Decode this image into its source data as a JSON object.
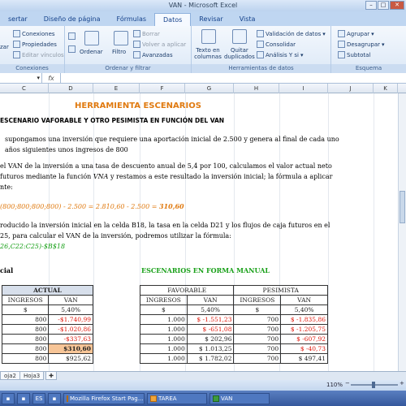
{
  "window": {
    "title": "VAN - Microsoft Excel"
  },
  "ribbon_tabs": [
    "sertar",
    "Diseño de página",
    "Fórmulas",
    "Datos",
    "Revisar",
    "Vista"
  ],
  "ribbon": {
    "conexiones": {
      "items": [
        "Conexiones",
        "Propiedades",
        "Editar vínculos"
      ],
      "group": "Conexiones",
      "left_partial": "zar"
    },
    "ordenar": {
      "sort_az": "A Z",
      "sort_za": "Z A",
      "ordenar": "Ordenar",
      "filtro": "Filtro",
      "borrar": "Borrar",
      "volver": "Volver a aplicar",
      "avanzadas": "Avanzadas",
      "group": "Ordenar y filtrar"
    },
    "herramientas": {
      "texto": "Texto en columnas",
      "quitar": "Quitar duplicados",
      "validacion": "Validación de datos",
      "consolidar": "Consolidar",
      "analisis": "Análisis Y si",
      "group": "Herramientas de datos"
    },
    "esquema": {
      "agrupar": "Agrupar",
      "desagrupar": "Desagrupar",
      "subtotal": "Subtotal",
      "group": "Esquema"
    }
  },
  "formula_bar": {
    "fx": "fx"
  },
  "columns": [
    "C",
    "D",
    "E",
    "F",
    "G",
    "H",
    "I",
    "J",
    "K"
  ],
  "sheet": {
    "title": "HERRAMIENTA ESCENARIOS",
    "subtitle": "ESCENARIO VAFORABLE Y OTRO PESIMISTA EN FUNCIÓN DEL VAN",
    "p1a": "supongamos una inversión que requiere una aportación inicial de 2.500 y genera al final de cada uno",
    "p1b": "años siguientes unos ingresos de 800",
    "p2a": "el VAN de la inversión a una tasa de descuento anual de 5,4 por 100, calculamos el valor actual neto",
    "p2b_pre": "futuros mediante la función ",
    "p2b_fn": "VNA",
    "p2b_post": " y restamos a este resultado la inversión inicial; la fórmula a aplicar",
    "p2c": "nte:",
    "formula_pre": "(800;800;800;800) - 2.500 = 2.810,60 - 2.500 = ",
    "formula_result": "310,60",
    "p3a": "roducido la inversión inicial en la celda B18, la tasa en la celda D21 y los flujos de caja futuros en el",
    "p3b": "25, para calcular el VAN de la inversión, podremos utilizar la fórmula:",
    "p3c": "26,C22:C25)-$B$18",
    "label_cial": "cial",
    "label_manual": "ESCENARIOS EN FORMA MANUAL"
  },
  "actual_table": {
    "header": "ACTUAL",
    "cols": [
      "INGRESOS",
      "VAN"
    ],
    "unit": [
      "$",
      "5,40%"
    ],
    "rows": [
      [
        "800",
        "-$1.740,99"
      ],
      [
        "800",
        "-$1.020,86"
      ],
      [
        "800",
        "-$337,63"
      ],
      [
        "800",
        "$310,60"
      ],
      [
        "800",
        "$925,62"
      ]
    ]
  },
  "scen_table": {
    "favorable": "FAVORABLE",
    "pesimista": "PESIMISTA",
    "cols": [
      "INGRESOS",
      "VAN",
      "INGRESOS",
      "VAN"
    ],
    "unit": [
      "$",
      "5,40%",
      "$",
      "5,40%"
    ],
    "rows": [
      [
        "1.000",
        "$ -1.551,23",
        "700",
        "$ -1.835,86"
      ],
      [
        "1.000",
        "$ -651,08",
        "700",
        "$ -1.205,75"
      ],
      [
        "1.000",
        "$ 202,96",
        "700",
        "$ -607,92"
      ],
      [
        "1.000",
        "$ 1.013,25",
        "700",
        "$ -40,73"
      ],
      [
        "1.000",
        "$ 1.782,02",
        "700",
        "$ 497,41"
      ]
    ]
  },
  "sheet_tabs": [
    "oja2",
    "Hoja3"
  ],
  "statusbar": {
    "zoom": "110%"
  },
  "taskbar": {
    "items": [
      "ES",
      "Mozilla Firefox Start Pag...",
      "TAREA",
      "VAN"
    ]
  },
  "colors": {
    "title": "#e07a10",
    "green": "#18a018",
    "negative": "#e0180c",
    "highlight": "#f7c597"
  }
}
